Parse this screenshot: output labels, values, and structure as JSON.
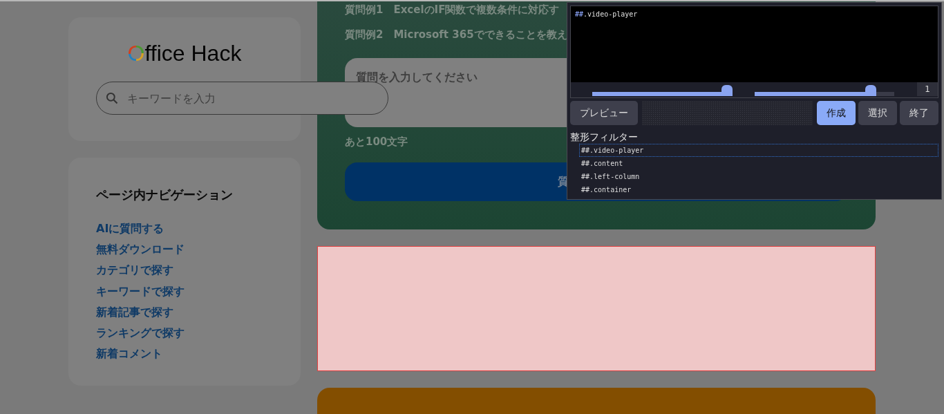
{
  "sidebar": {
    "logo": {
      "first_letter": "O",
      "rest": "ffice Hack"
    },
    "search": {
      "placeholder": "キーワードを入力"
    },
    "navigation": {
      "title": "ページ内ナビゲーション",
      "links": [
        "AIに質問する",
        "無料ダウンロード",
        "カテゴリで探す",
        "キーワードで探す",
        "新着記事で探す",
        "ランキングで探す",
        "新着コメント"
      ]
    }
  },
  "ai_card": {
    "examples": [
      "質問例1　ExcelのIF関数で複数条件に対応す",
      "質問例2　Microsoft 365でできることを教え"
    ],
    "question": {
      "placeholder": "質問を入力してください"
    },
    "remaining": "あと100文字",
    "submit": "質"
  },
  "filter_panel": {
    "preview_text": {
      "prefix": "##",
      "rest": ".video-player"
    },
    "sliders": [
      {
        "level": 0.96
      },
      {
        "level": 0.83
      }
    ],
    "counter": "1",
    "buttons": [
      {
        "label": "プレビュー",
        "kind": "plain"
      },
      {
        "label": "作成",
        "kind": "primary"
      },
      {
        "label": "選択",
        "kind": "plain"
      },
      {
        "label": "終了",
        "kind": "plain"
      }
    ],
    "filter_title": "整形フィルター",
    "filters": [
      {
        "label": "##.video-player",
        "selected": true
      },
      {
        "label": "##.content",
        "selected": false
      },
      {
        "label": "##.left-column",
        "selected": false
      },
      {
        "label": "##.container",
        "selected": false
      }
    ]
  }
}
